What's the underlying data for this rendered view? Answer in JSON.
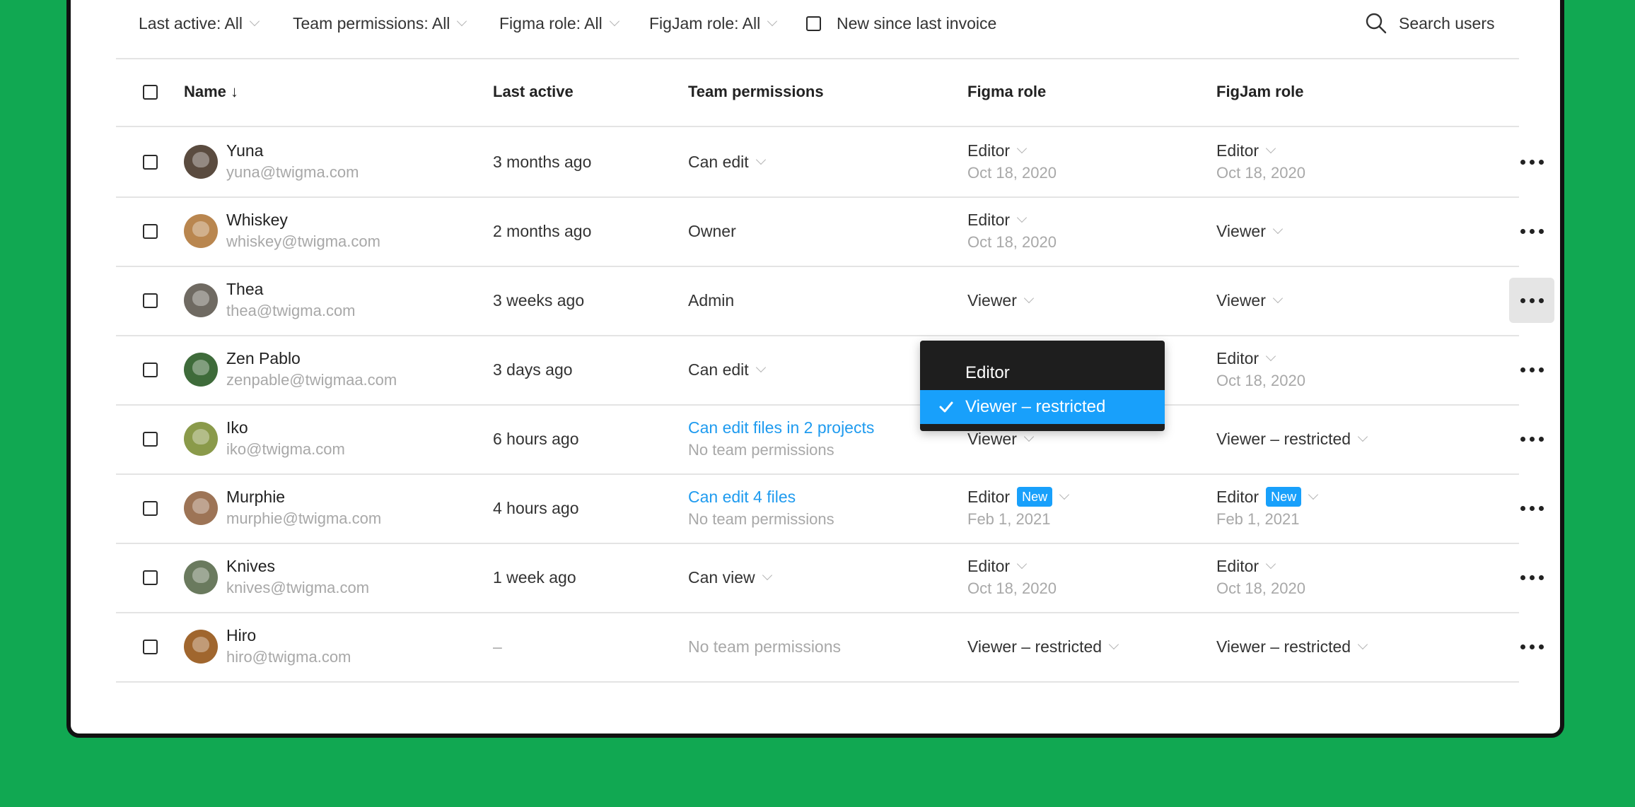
{
  "filters": {
    "last_active": "Last active: All",
    "team_permissions": "Team permissions: All",
    "figma_role": "Figma role: All",
    "figjam_role": "FigJam role: All",
    "new_since_invoice": "New since last invoice",
    "search_label": "Search users"
  },
  "table": {
    "headers": {
      "name": "Name ↓",
      "last_active": "Last active",
      "team_permissions": "Team permissions",
      "figma_role": "Figma role",
      "figjam_role": "FigJam role"
    },
    "rows": [
      {
        "name": "Yuna",
        "email": "yuna@twigma.com",
        "last_active": "3 months ago",
        "team_perm": "Can edit",
        "team_perm_sub": "",
        "figma_role": "Editor",
        "figma_date": "Oct 18, 2020",
        "figjam_role": "Editor",
        "figjam_date": "Oct 18, 2020",
        "avatar_color": "#5a4b3f"
      },
      {
        "name": "Whiskey",
        "email": "whiskey@twigma.com",
        "last_active": "2 months ago",
        "team_perm": "Owner",
        "team_perm_sub": "",
        "figma_role": "Editor",
        "figma_date": "Oct 18, 2020",
        "figjam_role": "Viewer",
        "figjam_date": "",
        "avatar_color": "#b9864f"
      },
      {
        "name": "Thea",
        "email": "thea@twigma.com",
        "last_active": "3 weeks ago",
        "team_perm": "Admin",
        "team_perm_sub": "",
        "figma_role": "Viewer",
        "figma_date": "",
        "figjam_role": "Viewer",
        "figjam_date": "",
        "avatar_color": "#6f6a62"
      },
      {
        "name": "Zen Pablo",
        "email": "zenpable@twigmaa.com",
        "last_active": "3 days ago",
        "team_perm": "Can edit",
        "team_perm_sub": "",
        "figma_role": "",
        "figma_date": "",
        "figjam_role": "Editor",
        "figjam_date": "Oct 18, 2020",
        "avatar_color": "#3e6b3a"
      },
      {
        "name": "Iko",
        "email": "iko@twigma.com",
        "last_active": "6 hours ago",
        "team_perm": "Can edit files in 2 projects",
        "team_perm_sub": "No team permissions",
        "figma_role": "Viewer",
        "figma_date": "",
        "figjam_role": "Viewer – restricted",
        "figjam_date": "",
        "avatar_color": "#8a9a4a"
      },
      {
        "name": "Murphie",
        "email": "murphie@twigma.com",
        "last_active": "4 hours ago",
        "team_perm": "Can edit 4 files",
        "team_perm_sub": "No team permissions",
        "figma_role": "Editor",
        "figma_badge": "New",
        "figma_date": "Feb 1, 2021",
        "figjam_role": "Editor",
        "figjam_badge": "New",
        "figjam_date": "Feb 1, 2021",
        "avatar_color": "#9d7456"
      },
      {
        "name": "Knives",
        "email": "knives@twigma.com",
        "last_active": "1 week ago",
        "team_perm": "Can view",
        "team_perm_sub": "",
        "figma_role": "Editor",
        "figma_date": "Oct 18, 2020",
        "figjam_role": "Editor",
        "figjam_date": "Oct 18, 2020",
        "avatar_color": "#6a7a5e"
      },
      {
        "name": "Hiro",
        "email": "hiro@twigma.com",
        "last_active": "–",
        "team_perm": "No team permissions",
        "team_perm_sub": "",
        "figma_role": "Viewer – restricted",
        "figma_date": "",
        "figjam_role": "Viewer – restricted",
        "figjam_date": "",
        "avatar_color": "#a0662e"
      }
    ]
  },
  "role_dropdown": {
    "items": [
      "Editor",
      "Viewer – restricted"
    ],
    "selected": "Viewer – restricted"
  },
  "colors": {
    "background": "#11a852",
    "accent": "#18a0fb",
    "link": "#1f9bef"
  }
}
